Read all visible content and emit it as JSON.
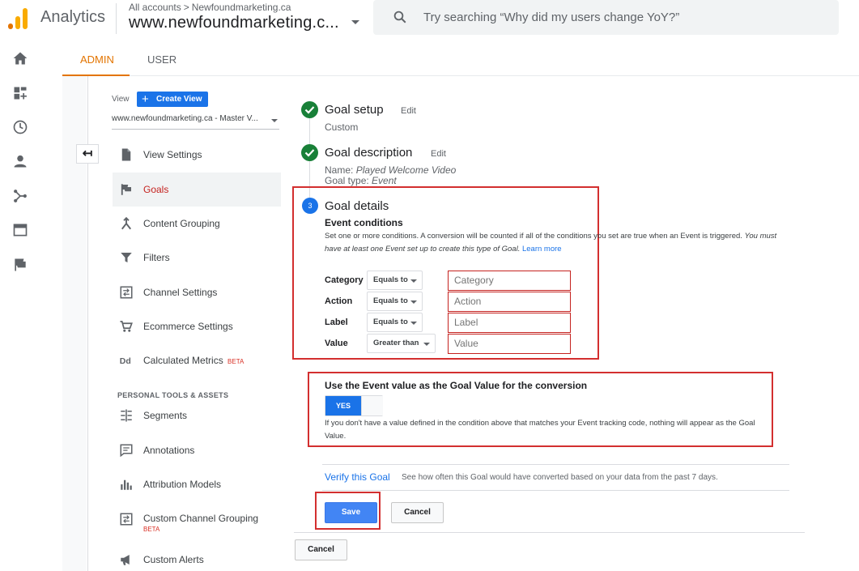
{
  "header": {
    "product": "Analytics",
    "breadcrumb": {
      "root": "All accounts",
      "separator": ">",
      "account": "Newfoundmarketing.ca"
    },
    "property_title": "www.newfoundmarketing.c...",
    "search_placeholder": "Try searching “Why did my users change YoY?”"
  },
  "rail_icons": [
    "home-icon",
    "customization-icon",
    "realtime-icon",
    "audience-icon",
    "acquisition-icon",
    "behavior-icon",
    "conversions-icon"
  ],
  "tabs": [
    {
      "label": "ADMIN",
      "active": true
    },
    {
      "label": "USER",
      "active": false
    }
  ],
  "view_panel": {
    "view_label": "View",
    "create_view_label": "Create View",
    "selected_view": "www.newfoundmarketing.ca - Master V...",
    "back_arrow": "↤"
  },
  "nav": {
    "items": [
      {
        "label": "View Settings",
        "icon": "document-icon",
        "active": false
      },
      {
        "label": "Goals",
        "icon": "flag-icon",
        "active": true
      },
      {
        "label": "Content Grouping",
        "icon": "grouping-icon",
        "active": false
      },
      {
        "label": "Filters",
        "icon": "filter-icon",
        "active": false
      },
      {
        "label": "Channel Settings",
        "icon": "channel-icon",
        "active": false
      },
      {
        "label": "Ecommerce Settings",
        "icon": "cart-icon",
        "active": false
      },
      {
        "label": "Calculated Metrics",
        "icon": "dd-icon",
        "active": false,
        "badge": "BETA"
      }
    ],
    "section_heading": "PERSONAL TOOLS & ASSETS",
    "tools": [
      {
        "label": "Segments",
        "icon": "segments-icon"
      },
      {
        "label": "Annotations",
        "icon": "annotation-icon"
      },
      {
        "label": "Attribution Models",
        "icon": "attribution-icon"
      },
      {
        "label": "Custom Channel Grouping",
        "icon": "channel-icon",
        "badge": "BETA"
      },
      {
        "label": "Custom Alerts",
        "icon": "megaphone-icon"
      }
    ]
  },
  "goal": {
    "setup": {
      "title": "Goal setup",
      "edit": "Edit",
      "value": "Custom"
    },
    "description": {
      "title": "Goal description",
      "edit": "Edit",
      "name_label": "Name:",
      "name_value": "Played Welcome Video",
      "type_label": "Goal type:",
      "type_value": "Event"
    },
    "details": {
      "step_number": "3",
      "title": "Goal details",
      "event_conditions_title": "Event conditions",
      "desc_normal": "Set one or more conditions. A conversion will be counted if all of the conditions you set are true when an Event is triggered. ",
      "desc_italic": "You must have at least one Event set up to create this type of Goal.",
      "learn_more": "Learn more",
      "conditions": [
        {
          "label": "Category",
          "operator": "Equals to",
          "placeholder": "Category"
        },
        {
          "label": "Action",
          "operator": "Equals to",
          "placeholder": "Action"
        },
        {
          "label": "Label",
          "operator": "Equals to",
          "placeholder": "Label"
        },
        {
          "label": "Value",
          "operator": "Greater than",
          "placeholder": "Value"
        }
      ]
    },
    "event_value": {
      "title": "Use the Event value as the Goal Value for the conversion",
      "toggle_label": "YES",
      "toggle_on": true,
      "note": "If you don't have a value defined in the condition above that matches your Event tracking code, nothing will appear as the Goal Value."
    },
    "verify": {
      "link": "Verify this Goal",
      "text": "See how often this Goal would have converted based on your data from the past 7 days."
    },
    "save_label": "Save",
    "cancel_label": "Cancel",
    "outer_cancel_label": "Cancel"
  },
  "colors": {
    "accent": "#e37400",
    "primary": "#1a73e8",
    "success": "#188038",
    "highlight": "#d32f2f"
  }
}
